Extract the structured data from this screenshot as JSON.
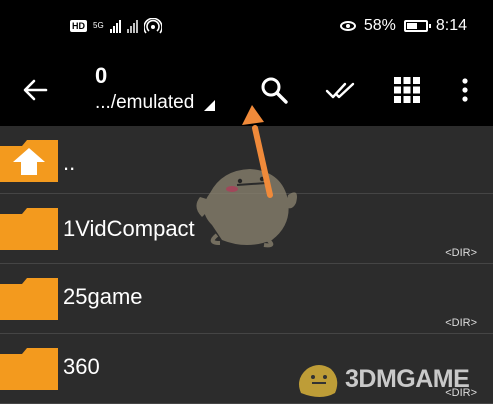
{
  "status_bar": {
    "hd_badge": "HD",
    "network_label": "5G",
    "battery_percent": "58%",
    "time": "8:14",
    "battery_level": 0.58
  },
  "toolbar": {
    "selected_count": "0",
    "path": ".../emulated"
  },
  "icons": [
    "arrow-left-icon",
    "search-icon",
    "double-check-icon",
    "grid-view-icon",
    "more-vert-icon",
    "folder-up-icon",
    "folder-icon"
  ],
  "list": {
    "parent_label": "..",
    "items": [
      {
        "name": "1VidCompact",
        "meta": "<DIR>"
      },
      {
        "name": "25game",
        "meta": "<DIR>"
      },
      {
        "name": "360",
        "meta": "<DIR>"
      }
    ]
  },
  "watermark": {
    "text": "3DMGAME"
  },
  "colors": {
    "bar_bg": "#000000",
    "list_bg": "#2c2c2c",
    "folder": "#f39a1e",
    "annotation_arrow": "#f08a3a"
  }
}
